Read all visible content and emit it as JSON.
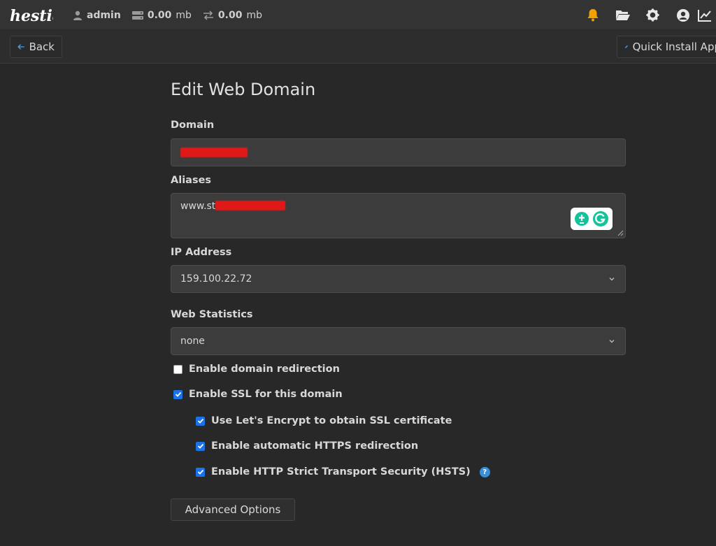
{
  "header": {
    "logo_text": "hestia",
    "user": "admin",
    "disk_value": "0.00",
    "disk_unit": "mb",
    "bandwidth_value": "0.00",
    "bandwidth_unit": "mb",
    "icons": [
      "bell-icon",
      "folder-icon",
      "gear-icon",
      "user-circle-icon",
      "chart-icon"
    ],
    "accent_color": "#f2a100"
  },
  "toolbar": {
    "back_label": "Back",
    "quick_install_label": "Quick Install App"
  },
  "form": {
    "title": "Edit Web Domain",
    "domain_label": "Domain",
    "domain_value": "",
    "aliases_label": "Aliases",
    "aliases_value_prefix": "www.st",
    "ip_label": "IP Address",
    "ip_value": "159.100.22.72",
    "stats_label": "Web Statistics",
    "stats_value": "none",
    "options": [
      {
        "label": "Enable domain redirection",
        "checked": false
      },
      {
        "label": "Enable SSL for this domain",
        "checked": true
      },
      {
        "label": "Use Let's Encrypt to obtain SSL certificate",
        "checked": true
      },
      {
        "label": "Enable automatic HTTPS redirection",
        "checked": true
      },
      {
        "label": "Enable HTTP Strict Transport Security (HSTS)",
        "checked": true
      }
    ],
    "help_glyph": "?",
    "advanced_label": "Advanced Options"
  }
}
